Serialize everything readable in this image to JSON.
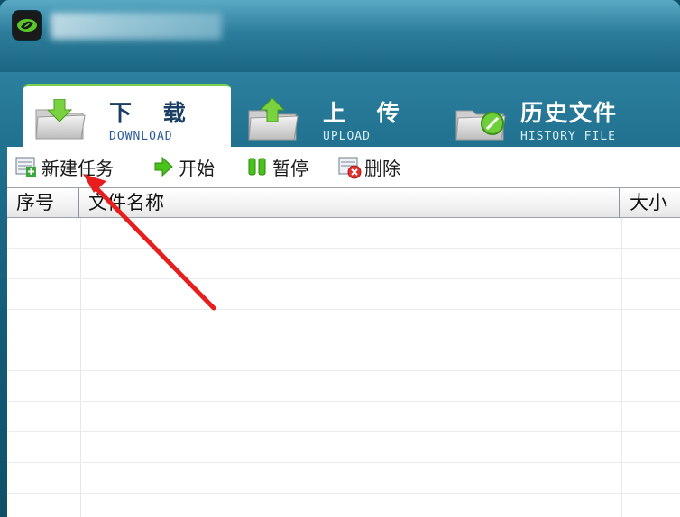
{
  "window": {
    "title_obscured": true
  },
  "tabs": [
    {
      "label_cn": "下 载",
      "label_en": "DOWNLOAD",
      "active": true,
      "icon": "download-folder-icon"
    },
    {
      "label_cn": "上 传",
      "label_en": "UPLOAD",
      "active": false,
      "icon": "upload-folder-icon"
    },
    {
      "label_cn": "历史文件",
      "label_en": "HISTORY FILE",
      "active": false,
      "icon": "history-folder-icon"
    }
  ],
  "toolbar": {
    "new_task_label": "新建任务",
    "start_label": "开始",
    "pause_label": "暂停",
    "delete_label": "删除"
  },
  "table": {
    "columns": [
      "序号",
      "文件名称",
      "大小"
    ],
    "rows": []
  },
  "colors": {
    "accent_green": "#79d14d",
    "header_blue": "#1b3f64",
    "annotation_red": "#e61e1e"
  }
}
